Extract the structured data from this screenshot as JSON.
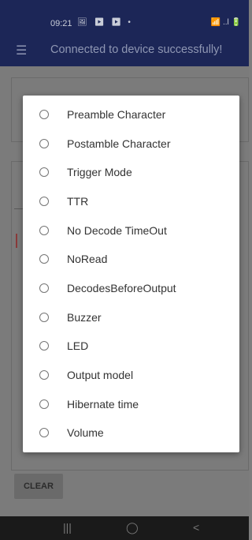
{
  "status_bar": {
    "time": "09:21",
    "notification_icons": "🖼 ▶ ▶ •",
    "system_icons": "📶 ..l 🔋"
  },
  "app_bar": {
    "menu_icon": "hamburger-menu-icon",
    "title": "Connected to device successfully!"
  },
  "background": {
    "clear_label": "CLEAR"
  },
  "dialog": {
    "options": [
      "Preamble Character",
      "Postamble Character",
      "Trigger Mode",
      "TTR",
      "No Decode TimeOut",
      "NoRead",
      "DecodesBeforeOutput",
      "Buzzer",
      "LED",
      "Output model",
      "Hibernate time",
      "Volume"
    ]
  },
  "nav_bar": {
    "recents": "|||",
    "home": "◯",
    "back": "<"
  }
}
